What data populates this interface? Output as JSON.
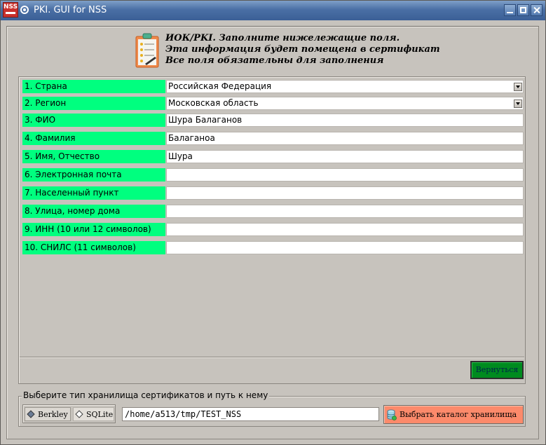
{
  "window": {
    "title": "PKI. GUI for NSS",
    "app_icon_text": "NSS"
  },
  "header": {
    "lines": [
      "ИОК/PKI. Заполните нижележащие поля.",
      "Эта информация будет помещена в сертификат",
      "Все поля обязательны для заполнения"
    ]
  },
  "form": {
    "rows": [
      {
        "label": "1. Страна",
        "value": "Российская Федерация",
        "kind": "combo"
      },
      {
        "label": "2. Регион",
        "value": "Московская область",
        "kind": "combo"
      },
      {
        "label": "3. ФИО",
        "value": "Шура Балаганов",
        "kind": "input"
      },
      {
        "label": "4. Фамилия",
        "value": "Балаганоа",
        "kind": "input"
      },
      {
        "label": "5. Имя, Отчество",
        "value": "Шура",
        "kind": "input"
      },
      {
        "label": "6. Электронная почта",
        "value": "",
        "kind": "input"
      },
      {
        "label": "7. Населенный пункт",
        "value": "",
        "kind": "input"
      },
      {
        "label": "8. Улица, номер дома",
        "value": "",
        "kind": "input"
      },
      {
        "label": "9. ИНН (10 или 12 символов)",
        "value": "",
        "kind": "input"
      },
      {
        "label": "10. СНИЛС (11 символов)",
        "value": "",
        "kind": "input"
      }
    ],
    "back_button": "Вернуться"
  },
  "storage": {
    "legend": "Выберите тип хранилища сертификатов и путь к нему",
    "options": [
      {
        "label": "Berkley",
        "selected": true
      },
      {
        "label": "SQLite",
        "selected": false
      }
    ],
    "path": "/home/a513/tmp/TEST_NSS",
    "choose_button": "Выбрать каталог хранилища"
  },
  "colors": {
    "label_bg": "#00ff7f",
    "back_button_bg": "#008b1f",
    "choose_button_bg": "#fc8a6b",
    "titlebar": "#4a6fa5"
  }
}
